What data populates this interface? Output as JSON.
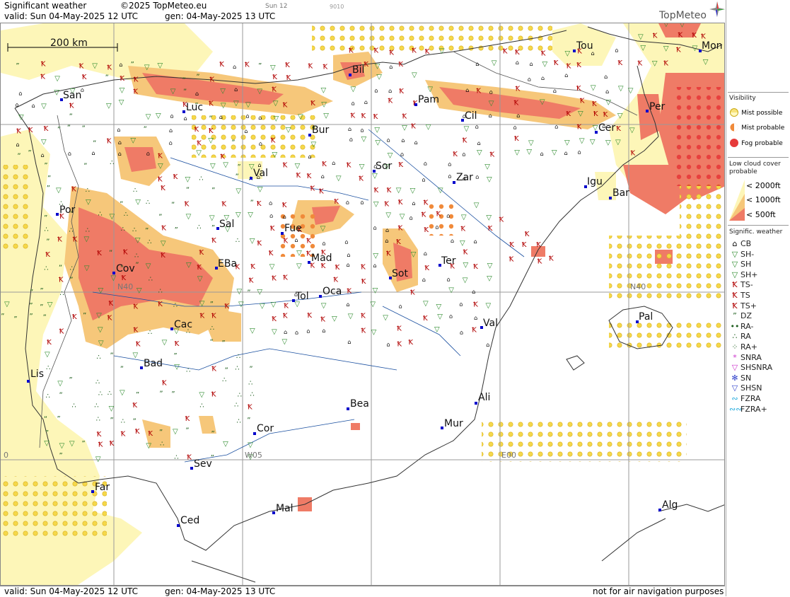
{
  "header": {
    "title": "Significant weather",
    "copyright": "©2025 TopMeteo.eu",
    "sub_left": "Sun 12",
    "sub_right": "9010",
    "valid_line": "valid:  Sun  04-May-2025  12 UTC",
    "gen_line": "gen: 04-May-2025 13 UTC",
    "brand": "TopMeteo"
  },
  "footer": {
    "valid_line": "valid:  Sun  04-May-2025  12 UTC",
    "gen_line": "gen: 04-May-2025 13 UTC",
    "disclaimer": "not for air navigation purposes"
  },
  "map": {
    "scale_label": "200 km",
    "grid_labels": [
      "N40",
      "N40",
      "W05",
      "E00",
      "0"
    ],
    "cities": [
      "San",
      "Luc",
      "Bil",
      "Pam",
      "Cil",
      "Tou",
      "Mon",
      "Per",
      "Cer",
      "Bur",
      "Sor",
      "Zar",
      "Val",
      "Igu",
      "Bar",
      "Por",
      "Sal",
      "Fue",
      "Mad",
      "Cov",
      "EBa",
      "Sot",
      "Ter",
      "Tol",
      "Oca",
      "Cac",
      "Val",
      "Pal",
      "Bad",
      "Lis",
      "Bea",
      "Ali",
      "Mur",
      "Cor",
      "Sev",
      "Far",
      "Mal",
      "Ced",
      "Alg"
    ]
  },
  "legend": {
    "visibility_title": "Visibility",
    "mist_possible": "Mist possible",
    "mist_probable": "Mist probable",
    "fog_probable": "Fog probable",
    "lowcloud_title": "Low cloud cover probable",
    "lc_2000": "< 2000ft",
    "lc_1000": "< 1000ft",
    "lc_500": "<   500ft",
    "signif_title": "Signific. weather",
    "symbols": [
      {
        "code": "CB",
        "glyph": "⌂",
        "color": "#000000"
      },
      {
        "code": "SH-",
        "glyph": "▽",
        "color": "#2e8b2e"
      },
      {
        "code": "SH",
        "glyph": "▽",
        "color": "#2e8b2e"
      },
      {
        "code": "SH+",
        "glyph": "▽",
        "color": "#2e8b2e"
      },
      {
        "code": "TS-",
        "glyph": "Ꝁ",
        "color": "#b00000"
      },
      {
        "code": "TS",
        "glyph": "Ꝁ",
        "color": "#b00000"
      },
      {
        "code": "TS+",
        "glyph": "Ꝁ",
        "color": "#b00000"
      },
      {
        "code": "DZ",
        "glyph": "”",
        "color": "#1d5e1d"
      },
      {
        "code": "RA-",
        "glyph": "••",
        "color": "#1d5e1d"
      },
      {
        "code": "RA",
        "glyph": "∴",
        "color": "#1d5e1d"
      },
      {
        "code": "RA+",
        "glyph": "⁘",
        "color": "#1d5e1d"
      },
      {
        "code": "SNRA",
        "glyph": "*",
        "color": "#cc33cc"
      },
      {
        "code": "SHSNRA",
        "glyph": "▽",
        "color": "#cc33cc"
      },
      {
        "code": "SN",
        "glyph": "✻",
        "color": "#3344cc"
      },
      {
        "code": "SHSN",
        "glyph": "▽",
        "color": "#3344cc"
      },
      {
        "code": "FZRA",
        "glyph": "∾",
        "color": "#22aadd"
      },
      {
        "code": "FZRA+",
        "glyph": "∾∾",
        "color": "#22aadd"
      }
    ]
  },
  "colors": {
    "mist_possible": "#f7e27a",
    "mist_probable": "#f08a3a",
    "fog_probable": "#e63a3a",
    "lc_2000": "#fdf6b8",
    "lc_1000": "#f6c77a",
    "lc_500": "#ef7b66",
    "city_marker": "#0000cc"
  }
}
